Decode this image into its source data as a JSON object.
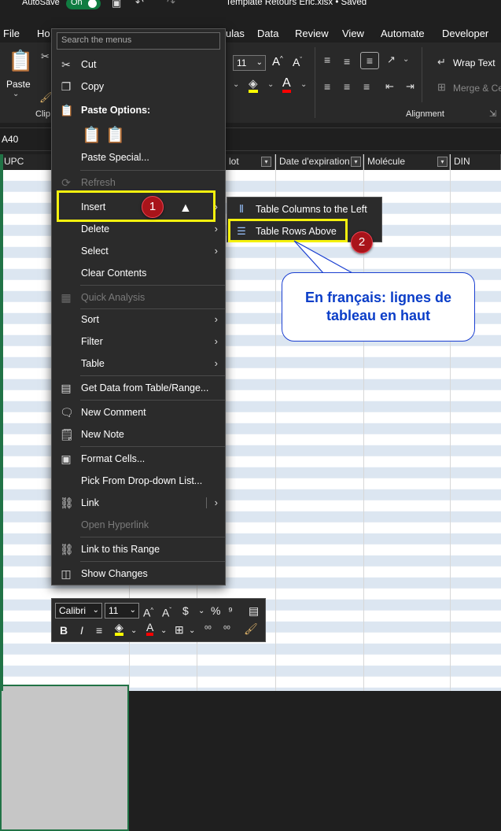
{
  "titlebar": {
    "autosave_label": "AutoSave",
    "autosave_state": "On",
    "document": "Template Retours Eric.xlsx • Saved"
  },
  "tabs": [
    {
      "label": "File"
    },
    {
      "label": "Ho"
    },
    {
      "label": "ulas"
    },
    {
      "label": "Data"
    },
    {
      "label": "Review"
    },
    {
      "label": "View"
    },
    {
      "label": "Automate"
    },
    {
      "label": "Developer"
    }
  ],
  "ribbon": {
    "paste_label": "Paste",
    "clipboard_label": "Clip",
    "font_size": "11",
    "wrap_text": "Wrap Text",
    "merge_center": "Merge & Ce",
    "alignment_label": "Alignment"
  },
  "formula_bar": {
    "name_box": "A40"
  },
  "sheet": {
    "headers": [
      "UPC",
      "lot",
      "Date d'expiration",
      "Molécule",
      "DIN"
    ]
  },
  "context_menu": {
    "search_placeholder": "Search the menus",
    "items": [
      {
        "label": "Cut",
        "icon": "scissors-icon"
      },
      {
        "label": "Copy",
        "icon": "copy-icon"
      },
      {
        "label": "Paste Options:",
        "icon": "paste-icon"
      },
      {
        "label": "Paste Special...",
        "icon": ""
      },
      {
        "label": "Refresh",
        "icon": "refresh-icon",
        "disabled": true
      },
      {
        "label": "Insert",
        "icon": "",
        "submenu": true
      },
      {
        "label": "Delete",
        "icon": "",
        "submenu": true
      },
      {
        "label": "Select",
        "icon": "",
        "submenu": true
      },
      {
        "label": "Clear Contents",
        "icon": ""
      },
      {
        "label": "Quick Analysis",
        "icon": "quick-analysis-icon",
        "disabled": true
      },
      {
        "label": "Sort",
        "icon": "",
        "submenu": true
      },
      {
        "label": "Filter",
        "icon": "",
        "submenu": true
      },
      {
        "label": "Table",
        "icon": "",
        "submenu": true
      },
      {
        "label": "Get Data from Table/Range...",
        "icon": "table-icon"
      },
      {
        "label": "New Comment",
        "icon": "comment-icon"
      },
      {
        "label": "New Note",
        "icon": "note-icon"
      },
      {
        "label": "Format Cells...",
        "icon": "format-cells-icon"
      },
      {
        "label": "Pick From Drop-down List...",
        "icon": ""
      },
      {
        "label": "Link",
        "icon": "link-icon",
        "submenu": true
      },
      {
        "label": "Open Hyperlink",
        "icon": "",
        "disabled": true
      },
      {
        "label": "Link to this Range",
        "icon": "link-range-icon"
      },
      {
        "label": "Show Changes",
        "icon": "show-changes-icon"
      }
    ]
  },
  "submenu": {
    "items": [
      {
        "label": "Table Columns to the Left",
        "icon": "insert-columns-icon"
      },
      {
        "label": "Table Rows Above",
        "icon": "insert-rows-icon"
      }
    ]
  },
  "annotations": {
    "step1": "1",
    "step2": "2",
    "callout_line1": "En français: lignes de",
    "callout_line2": "tableau en haut",
    "highlight_color": "#f5f10e",
    "badge_color": "#a9141a",
    "callout_color": "#0a3dc8"
  },
  "mini_toolbar": {
    "font": "Calibri",
    "size": "11"
  },
  "colors": {
    "accent": "#217346",
    "menu_bg": "#2b2b2b",
    "row_band": "#dce6f1"
  }
}
